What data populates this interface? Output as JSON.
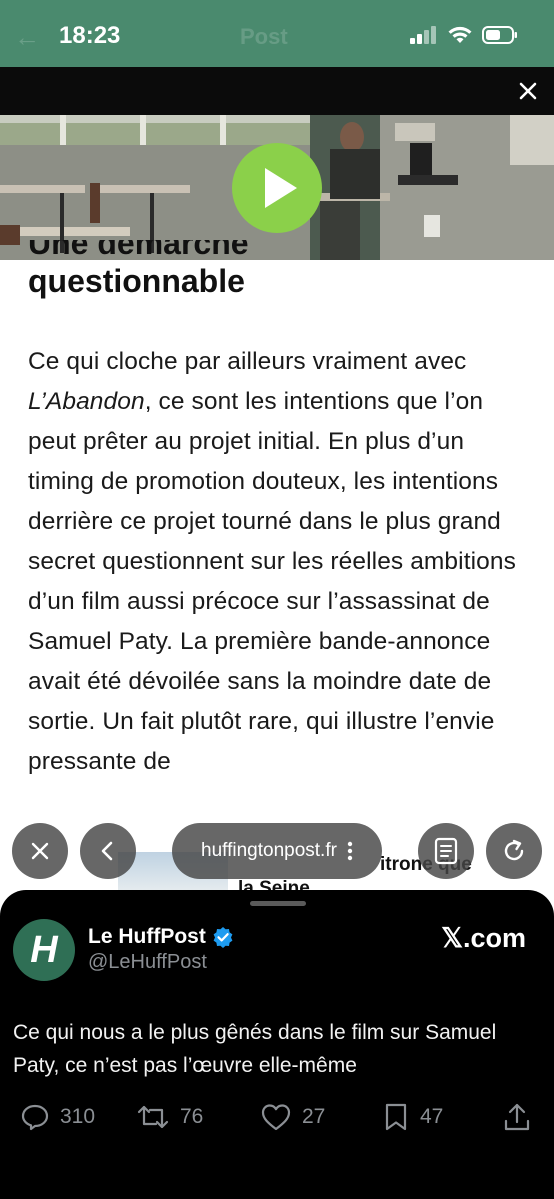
{
  "status_bar": {
    "time": "18:23",
    "ghost_title": "Post",
    "icons": [
      "cellular-signal-icon",
      "wifi-icon",
      "battery-icon"
    ]
  },
  "video": {
    "close_icon": "close-icon",
    "play_icon": "play-icon"
  },
  "article": {
    "heading_line1": "Une démarche",
    "heading_line2": "questionnable",
    "paragraph_part1": "Ce qui cloche par ailleurs vraiment avec ",
    "paragraph_italic": "L’Abandon",
    "paragraph_part2": ", ce sont les intentions que l’on peut prêter au projet initial. En plus d’un timing de promotion douteux, les intentions derrière ce projet tourné dans le plus grand secret questionnent sur les réelles ambitions d’un film aussi précoce sur l’assassinat de Samuel Paty. La première bande-annonce avait été dévoilée sans la moindre date de sortie. Un fait plutôt rare, qui illustre l’envie pressante de"
  },
  "browser": {
    "url": "huffingtonpost.fr",
    "peek_text_line1": "itrone que",
    "peek_text_line2": "la Seine"
  },
  "tweet": {
    "display_name": "Le HuffPost",
    "handle": "@LeHuffPost",
    "avatar_letter": "H",
    "source": "𝕏.com",
    "text": "Ce qui nous a le plus gênés dans le film sur Samuel Paty, ce n’est pas l’œuvre elle-même",
    "replies": "310",
    "reposts": "76",
    "likes": "27",
    "bookmarks": "47"
  },
  "colors": {
    "status_bar": "#4a8a6e",
    "play_button": "#8bd04a",
    "verified": "#1d9bf0",
    "sheet_bg": "#000000"
  }
}
